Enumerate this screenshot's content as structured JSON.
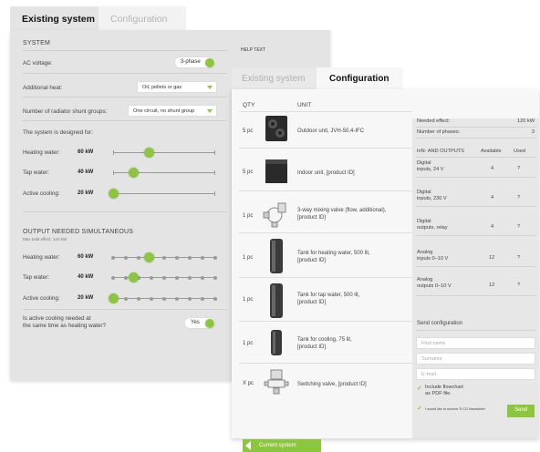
{
  "back_panel": {
    "tabs": [
      "Existing system",
      "Configuration"
    ],
    "section_system": "SYSTEM",
    "ac_voltage_label": "AC voltage:",
    "ac_voltage_value": "3-phase",
    "additional_heat_label": "Additional heat:",
    "additional_heat_value": "Oil, pellets or gas",
    "shunt_groups_label": "Number of radiator shunt groups:",
    "shunt_groups_value": "One circuit, no shunt group",
    "designed_for": "The system is designed for:",
    "design": [
      {
        "label": "Heating water:",
        "value": "60 kW",
        "level": 0.35
      },
      {
        "label": "Tap water:",
        "value": "40 kW",
        "level": 0.2
      },
      {
        "label": "Active cooling:",
        "value": "20 kW",
        "level": 0.0
      }
    ],
    "section_output": "OUTPUT NEEDED SIMULTANEOUS",
    "max_effect": "Max total effect: 140 kW",
    "output": [
      {
        "label": "Heating water:",
        "value": "60 kW",
        "level": 0.35
      },
      {
        "label": "Tap water:",
        "value": "40 kW",
        "level": 0.2
      },
      {
        "label": "Active cooling:",
        "value": "20 kW",
        "level": 0.0
      }
    ],
    "active_cooling_q": [
      "Is active cooling needed at",
      "the same time as heating water?"
    ],
    "active_cooling_value": "Yes",
    "help_text": "HELP TEXT"
  },
  "front_panel": {
    "tabs": [
      "Existing system",
      "Configuration"
    ],
    "col_qty": "QTY",
    "col_unit": "UNIT",
    "units": [
      {
        "qty": "5 pc",
        "name": [
          "Outdoor unit, JVH-50.4-IFC"
        ],
        "icon": "outdoor-unit-icon"
      },
      {
        "qty": "5 pc",
        "name": [
          "Indoor unit, [product ID]"
        ],
        "icon": "indoor-unit-icon"
      },
      {
        "qty": "1 pc",
        "name": [
          "3-way mixing valve (flow, additional),",
          "[product ID]"
        ],
        "icon": "mixing-valve-icon"
      },
      {
        "qty": "1 pc",
        "name": [
          "Tank for heating water, 500 lit,",
          "[product ID]"
        ],
        "icon": "tank-icon"
      },
      {
        "qty": "1 pc",
        "name": [
          "Tank for tap water, 500 lit,",
          "[product ID]"
        ],
        "icon": "tank-icon"
      },
      {
        "qty": "1 pc",
        "name": [
          "Tank for cooling, 75 lit,",
          "[product ID]"
        ],
        "icon": "small-tank-icon"
      },
      {
        "qty": "X pc",
        "name": [
          "Switching valve, [product ID]"
        ],
        "icon": "switching-valve-icon"
      }
    ],
    "needed_effect_label": "Needed effect:",
    "needed_effect_value": "120 kW",
    "phases_label": "Number of phases:",
    "phases_value": "3",
    "io_header": "InN- AND OUTPUTS",
    "io_available": "Available",
    "io_used": "Used",
    "io_rows": [
      {
        "name": [
          "Digital",
          "inputs, 24 V"
        ],
        "available": "4",
        "used": "?"
      },
      {
        "name": [
          "Digital",
          "inputs, 230 V"
        ],
        "available": "4",
        "used": "?"
      },
      {
        "name": [
          "Digital",
          "outputs, relay"
        ],
        "available": "4",
        "used": "?"
      },
      {
        "name": [
          "Analog",
          "inputs 0–10 V"
        ],
        "available": "12",
        "used": "?"
      },
      {
        "name": [
          "Analog",
          "outputs 0–10 V"
        ],
        "available": "12",
        "used": "?"
      }
    ],
    "send_config": "Send configuration",
    "first_name_placeholder": "First name",
    "surname_placeholder": "Surname",
    "email_placeholder": "E-mail",
    "include_flowchart": [
      "Include flowchart",
      "as PDF file."
    ],
    "newsletter": "I would like to receive ®-CD Newsletter",
    "send_button": "Send",
    "back_button": "Current system"
  },
  "colors": {
    "accent": "#8cc63f",
    "panel_back": "#e4e4e4",
    "panel_front": "#f7f7f7"
  }
}
